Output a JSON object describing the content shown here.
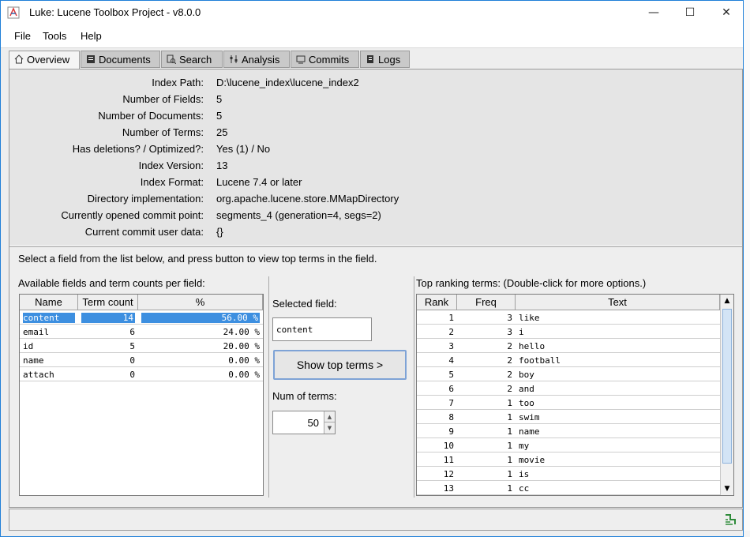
{
  "window": {
    "title": "Luke: Lucene Toolbox Project - v8.0.0",
    "controls": {
      "minimize": "—",
      "maximize": "☐",
      "close": "✕"
    }
  },
  "menu": [
    "File",
    "Tools",
    "Help"
  ],
  "tabs": [
    {
      "label": "Overview",
      "icon": "home-icon",
      "active": true
    },
    {
      "label": "Documents",
      "icon": "documents-icon",
      "active": false
    },
    {
      "label": "Search",
      "icon": "search-icon",
      "active": false
    },
    {
      "label": "Analysis",
      "icon": "analysis-icon",
      "active": false
    },
    {
      "label": "Commits",
      "icon": "commits-icon",
      "active": false
    },
    {
      "label": "Logs",
      "icon": "logs-icon",
      "active": false
    }
  ],
  "overview": [
    {
      "label": "Index Path:",
      "value": "D:\\lucene_index\\lucene_index2"
    },
    {
      "label": "Number of Fields:",
      "value": "5"
    },
    {
      "label": "Number of Documents:",
      "value": "5"
    },
    {
      "label": "Number of Terms:",
      "value": "25"
    },
    {
      "label": "Has deletions? / Optimized?:",
      "value": "Yes (1) / No"
    },
    {
      "label": "Index Version:",
      "value": "13"
    },
    {
      "label": "Index Format:",
      "value": "Lucene 7.4 or later"
    },
    {
      "label": "Directory implementation:",
      "value": "org.apache.lucene.store.MMapDirectory"
    },
    {
      "label": "Currently opened commit point:",
      "value": "segments_4 (generation=4, segs=2)"
    },
    {
      "label": "Current commit user data:",
      "value": "{}"
    }
  ],
  "prompt": "Select a field from the list below, and press button to view top terms in the field.",
  "fields_panel": {
    "label": "Available fields and term counts per field:",
    "columns": [
      "Name",
      "Term count",
      "%"
    ],
    "rows": [
      {
        "name": "content",
        "count": "14",
        "pct": "56.00 %",
        "selected": true
      },
      {
        "name": "email",
        "count": "6",
        "pct": "24.00 %",
        "selected": false
      },
      {
        "name": "id",
        "count": "5",
        "pct": "20.00 %",
        "selected": false
      },
      {
        "name": "name",
        "count": "0",
        "pct": "0.00 %",
        "selected": false
      },
      {
        "name": "attach",
        "count": "0",
        "pct": "0.00 %",
        "selected": false
      }
    ]
  },
  "middle": {
    "selected_field_label": "Selected field:",
    "selected_field_value": "content",
    "show_button": "Show top terms >",
    "num_terms_label": "Num of terms:",
    "num_terms_value": "50"
  },
  "terms_panel": {
    "label": "Top ranking terms: (Double-click for more options.)",
    "columns": [
      "Rank",
      "Freq",
      "Text"
    ],
    "rows": [
      {
        "rank": "1",
        "freq": "3",
        "text": "like"
      },
      {
        "rank": "2",
        "freq": "3",
        "text": "i"
      },
      {
        "rank": "3",
        "freq": "2",
        "text": "hello"
      },
      {
        "rank": "4",
        "freq": "2",
        "text": "football"
      },
      {
        "rank": "5",
        "freq": "2",
        "text": "boy"
      },
      {
        "rank": "6",
        "freq": "2",
        "text": "and"
      },
      {
        "rank": "7",
        "freq": "1",
        "text": "too"
      },
      {
        "rank": "8",
        "freq": "1",
        "text": "swim"
      },
      {
        "rank": "9",
        "freq": "1",
        "text": "name"
      },
      {
        "rank": "10",
        "freq": "1",
        "text": "my"
      },
      {
        "rank": "11",
        "freq": "1",
        "text": "movie"
      },
      {
        "rank": "12",
        "freq": "1",
        "text": "is"
      },
      {
        "rank": "13",
        "freq": "1",
        "text": "cc"
      }
    ]
  },
  "colors": {
    "selection": "#3d8fe0",
    "accent": "#1f7fd8"
  }
}
